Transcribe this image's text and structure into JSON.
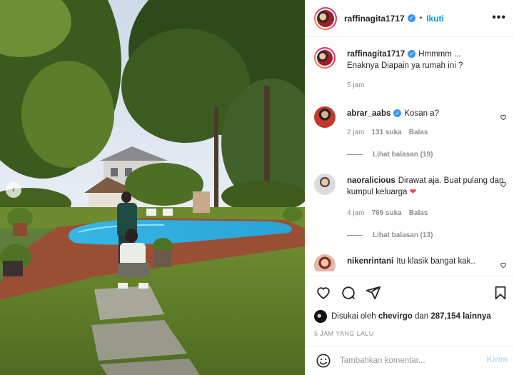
{
  "post": {
    "username": "raffinagita1717",
    "follow_label": "Ikuti",
    "dot": "•",
    "more_label": "•••",
    "nav_prev": "‹"
  },
  "caption": {
    "username": "raffinagita1717",
    "line1": "Hmmmm ...",
    "line2": "Enaknya Diapain ya rumah ini ?",
    "time": "5 jam"
  },
  "comments": [
    {
      "username": "abrar_aabs",
      "verified": true,
      "text": "Kosan a?",
      "time": "2 jam",
      "likes": "131 suka",
      "reply": "Balas",
      "view_replies": "Lihat balasan (19)"
    },
    {
      "username": "naoralicious",
      "verified": false,
      "text": "Dirawat aja. Buat pulang dan kumpul keluarga",
      "heart_emoji": "❤",
      "time": "4 jam",
      "likes": "769 suka",
      "reply": "Balas",
      "view_replies": "Lihat balasan (13)"
    },
    {
      "username": "nikenrintani",
      "verified": false,
      "text": "Itu klasik bangat kak.."
    }
  ],
  "liked_by": {
    "prefix": "Disukai oleh",
    "user": "chevirgo",
    "middle": "dan",
    "count": "287,154",
    "suffix": "lainnya"
  },
  "timestamp": "5 JAM YANG LALU",
  "composer": {
    "placeholder": "Tambahkan komentar...",
    "post_label": "Kirim"
  },
  "colors": {
    "accent": "#0095f6",
    "verified": "#3897f0",
    "heart": "#ed4956"
  }
}
